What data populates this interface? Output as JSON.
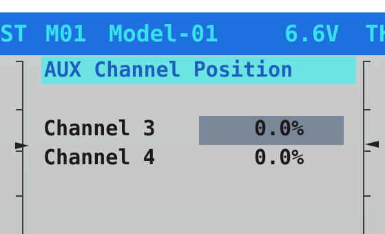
{
  "status_bar": {
    "left_trim_label": "ST",
    "model_number": "M01",
    "model_name": "Model-01",
    "voltage": "6.6V",
    "right_trim_label": "TH"
  },
  "screen": {
    "title": "AUX Channel Position"
  },
  "channels": [
    {
      "label": "Channel 3",
      "value": "0.0%",
      "selected": true
    },
    {
      "label": "Channel 4",
      "value": "0.0%",
      "selected": false
    }
  ],
  "colors": {
    "status_bar_bg": "#1f6fe0",
    "status_text": "#36e3ec",
    "heading_bg": "#6ee3e3",
    "heading_text": "#1d5fbf",
    "selection_bg": "#7a8799",
    "screen_bg": "#c4c7c6"
  }
}
